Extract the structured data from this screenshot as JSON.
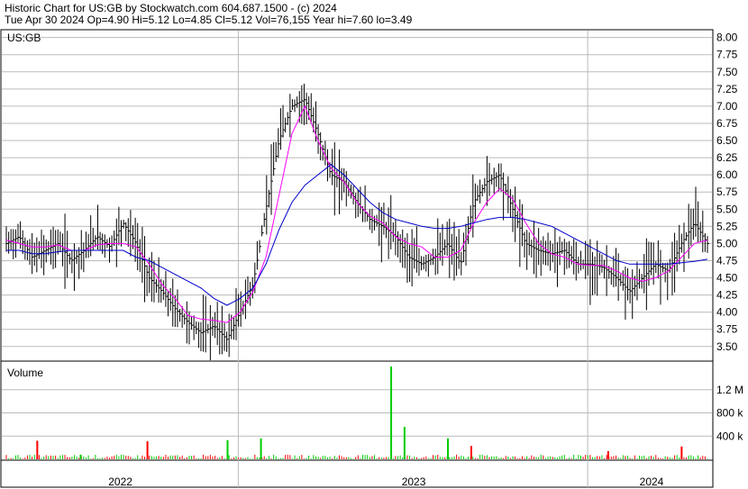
{
  "header": {
    "line1": "Historic Chart for US:GB by Stockwatch.com 604.687.1500 - (c) 2024",
    "line2": "Tue Apr 30 2024  Op=4.90  Hi=5.12  Lo=4.85  Cl=5.12  Vol=76,155  Year hi=7.60  lo=3.49"
  },
  "chart_data": [
    {
      "type": "line",
      "panel": "price",
      "title": "US:GB",
      "y_ticks": [
        "8.00",
        "7.75",
        "7.50",
        "7.25",
        "7.00",
        "6.75",
        "6.50",
        "6.25",
        "6.00",
        "5.75",
        "5.50",
        "5.25",
        "5.00",
        "4.75",
        "4.50",
        "4.25",
        "4.00",
        "3.75",
        "3.50"
      ],
      "ylim": [
        3.3,
        8.1
      ],
      "x_labels": [
        "2022",
        "2023",
        "2024"
      ],
      "grid": true,
      "colors": {
        "price": "#000000",
        "ma_short": "#ff00ff",
        "ma_long": "#0000cc"
      },
      "series": [
        {
          "key": "price",
          "values": [
            5.0,
            5.1,
            4.8,
            4.9,
            5.0,
            4.75,
            4.9,
            5.1,
            4.95,
            5.3,
            5.0,
            4.5,
            4.3,
            4.05,
            3.85,
            3.7,
            3.8,
            3.6,
            4.0,
            4.4,
            5.5,
            6.5,
            7.0,
            7.1,
            6.6,
            6.0,
            5.9,
            5.6,
            5.35,
            5.25,
            5.1,
            4.8,
            4.7,
            4.8,
            5.0,
            4.7,
            5.6,
            5.9,
            6.0,
            5.5,
            5.0,
            4.9,
            4.85,
            4.9,
            4.7,
            4.7,
            4.65,
            4.5,
            4.3,
            4.5,
            4.7,
            4.6,
            5.0,
            5.3,
            5.0
          ]
        },
        {
          "key": "ma_short",
          "values": [
            5.05,
            5.0,
            4.95,
            4.95,
            4.98,
            4.9,
            4.9,
            4.98,
            5.0,
            5.0,
            4.95,
            4.7,
            4.4,
            4.2,
            3.95,
            3.9,
            3.88,
            3.85,
            4.0,
            4.3,
            4.8,
            5.7,
            6.6,
            7.0,
            6.5,
            6.1,
            5.9,
            5.6,
            5.4,
            5.3,
            5.1,
            5.0,
            4.95,
            4.8,
            4.8,
            4.9,
            5.3,
            5.6,
            5.8,
            5.65,
            5.3,
            5.0,
            4.85,
            4.8,
            4.7,
            4.68,
            4.68,
            4.6,
            4.5,
            4.45,
            4.5,
            4.6,
            4.8,
            5.0,
            5.05
          ]
        },
        {
          "key": "ma_long",
          "values": [
            4.9,
            4.9,
            4.85,
            4.85,
            4.88,
            4.9,
            4.9,
            4.9,
            4.9,
            4.9,
            4.8,
            4.75,
            4.65,
            4.55,
            4.45,
            4.35,
            4.2,
            4.1,
            4.2,
            4.35,
            4.7,
            5.2,
            5.6,
            5.85,
            6.0,
            6.15,
            6.0,
            5.8,
            5.6,
            5.45,
            5.35,
            5.3,
            5.25,
            5.22,
            5.22,
            5.25,
            5.3,
            5.35,
            5.38,
            5.38,
            5.35,
            5.3,
            5.25,
            5.15,
            5.05,
            4.95,
            4.85,
            4.75,
            4.7,
            4.7,
            4.7,
            4.7,
            4.72,
            4.74,
            4.77
          ]
        }
      ]
    },
    {
      "type": "bar",
      "panel": "volume",
      "title": "Volume",
      "y_ticks": [
        "1.2 M",
        "800 k",
        "400 k"
      ],
      "ylim": [
        0,
        1600000
      ],
      "spikes": [
        {
          "pos": 0.09,
          "v": 320000,
          "color": "#ff0000"
        },
        {
          "pos": 0.22,
          "v": 80000,
          "color": "#00cc00"
        },
        {
          "pos": 0.42,
          "v": 310000,
          "color": "#ff0000"
        },
        {
          "pos": 0.66,
          "v": 330000,
          "color": "#00cc00"
        },
        {
          "pos": 0.76,
          "v": 360000,
          "color": "#00cc00"
        },
        {
          "pos": 1.15,
          "v": 1600000,
          "color": "#00cc00"
        },
        {
          "pos": 1.19,
          "v": 560000,
          "color": "#00cc00"
        },
        {
          "pos": 1.32,
          "v": 360000,
          "color": "#00cc00"
        },
        {
          "pos": 1.39,
          "v": 230000,
          "color": "#ff0000"
        },
        {
          "pos": 1.8,
          "v": 140000,
          "color": "#ff0000"
        },
        {
          "pos": 2.02,
          "v": 220000,
          "color": "#ff0000"
        }
      ]
    }
  ]
}
